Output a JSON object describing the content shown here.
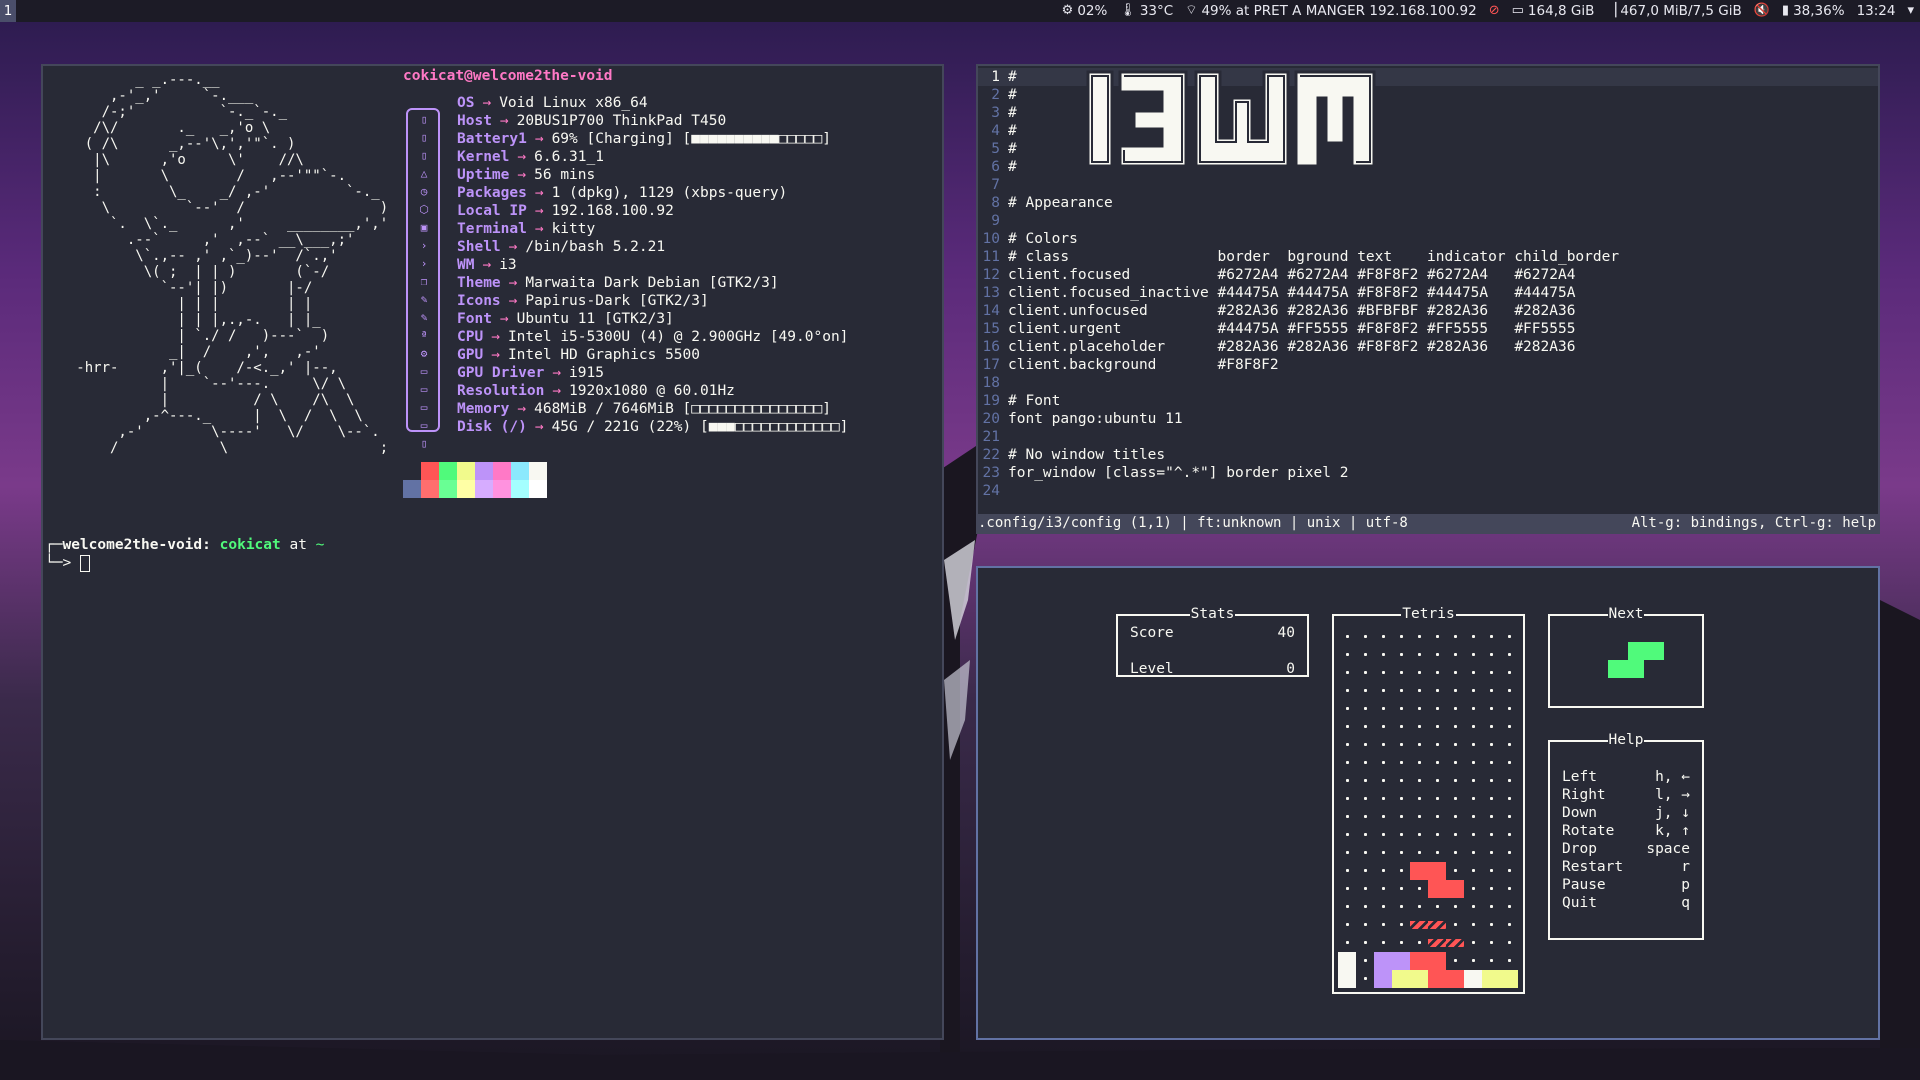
{
  "topbar": {
    "workspace": "1",
    "cpu": "02%",
    "temp": "33°C",
    "wifi": "49% at PRET A MANGER 192.168.100.92",
    "disk": "164,8 GiB",
    "memory": "467,0 MiB/7,5 GiB",
    "battery": "38,36%",
    "clock": "13:24"
  },
  "fastfetch": {
    "title": "cokicat@welcome2the-void",
    "ascii_art": "          _ _.---.__\n       ,-'_,'     `-.___\n      /-;'          `-._`-._\n     /\\/       ._   _,'o \\\n    ( /\\      _,--'\\,','\"`. )\n     |\\      ,'o     \\'    //\\\n     |       \\        /   ,--'\"\"`-.\n     :        \\_    _/ ,-'         `-._\n      \\         `--'  /                )\n       `.  \\`._      ,'     ________,','\n         .--`     ,'  ,--` __\\___,;'\n          \\`.,-- ,' ,`_)--'  /`.,'\n           \\( ;  | | )       (`-/\n             `--'| |)       |-/\n               | | |        | |\n               | | |,.,-.   | |_\n               | `./ /   )---`  )\n              _|  /    ,',   ,-'\n   -hrr-     ,'|_(    /-<._,' |--,\n             |    `--'---.     \\/ \\\n             |          / \\    /\\  \\\n           ,-^---._     |  \\  /  \\  \\\n        ,-'        \\----'   \\/    \\--`.\n       /            \\                  ;",
    "rows": [
      {
        "key": "OS",
        "value": "Void Linux x86_64",
        "icon": "os-icon",
        "glyph": "▯"
      },
      {
        "key": "Host",
        "value": "20BUS1P700 ThinkPad T450",
        "icon": "host-icon",
        "glyph": "▯"
      },
      {
        "key": "Battery1",
        "value": "69% [Charging] [■■■■■■■■■■□□□□□]",
        "icon": "battery-icon",
        "glyph": "▯"
      },
      {
        "key": "Kernel",
        "value": "6.6.31_1",
        "icon": "kernel-icon",
        "glyph": "△"
      },
      {
        "key": "Uptime",
        "value": "56 mins",
        "icon": "clock-icon",
        "glyph": "◷"
      },
      {
        "key": "Packages",
        "value": "1 (dpkg), 1129 (xbps-query)",
        "icon": "package-icon",
        "glyph": "⬡"
      },
      {
        "key": "Local IP",
        "value": "192.168.100.92",
        "icon": "network-icon",
        "glyph": "▣"
      },
      {
        "key": "Terminal",
        "value": "kitty",
        "icon": "terminal-icon",
        "glyph": "›"
      },
      {
        "key": "Shell",
        "value": "/bin/bash 5.2.21",
        "icon": "shell-icon",
        "glyph": "›"
      },
      {
        "key": "WM",
        "value": "i3",
        "icon": "window-icon",
        "glyph": "❐"
      },
      {
        "key": "Theme",
        "value": "Marwaita Dark Debian [GTK2/3]",
        "icon": "brush-icon",
        "glyph": "✎"
      },
      {
        "key": "Icons",
        "value": "Papirus-Dark [GTK2/3]",
        "icon": "brush-icon",
        "glyph": "✎"
      },
      {
        "key": "Font",
        "value": "Ubuntu 11 [GTK2/3]",
        "icon": "font-icon",
        "glyph": "ª"
      },
      {
        "key": "CPU",
        "value": "Intel i5-5300U (4) @ 2.900GHz [49.0°on]",
        "icon": "cpu-icon",
        "glyph": "⚙"
      },
      {
        "key": "GPU",
        "value": "Intel HD Graphics 5500",
        "icon": "monitor-icon",
        "glyph": "▭"
      },
      {
        "key": "GPU Driver",
        "value": "i915",
        "icon": "monitor-icon",
        "glyph": "▭"
      },
      {
        "key": "Resolution",
        "value": "1920x1080 @ 60.01Hz",
        "icon": "monitor-icon",
        "glyph": "▭"
      },
      {
        "key": "Memory",
        "value": "468MiB / 7646MiB [□□□□□□□□□□□□□□□]",
        "icon": "memory-icon",
        "glyph": "▭"
      },
      {
        "key": "Disk (/)",
        "value": "45G / 221G (22%) [■■■□□□□□□□□□□□□]",
        "icon": "disk-icon",
        "glyph": "▯"
      }
    ],
    "palette_top": [
      "#282a36",
      "#ff5555",
      "#50fa7b",
      "#f1fa8c",
      "#bd93f9",
      "#ff79c6",
      "#8be9fd",
      "#f8f8f2"
    ],
    "palette_bottom": [
      "#6272a4",
      "#ff6e6e",
      "#69ff94",
      "#ffffa5",
      "#d6acff",
      "#ff92df",
      "#a4ffff",
      "#ffffff"
    ]
  },
  "prompt": {
    "host": "welcome2the-void",
    "user": "cokicat",
    "at": "at",
    "dir": "~"
  },
  "vim": {
    "lines": [
      {
        "n": "1",
        "t": "#"
      },
      {
        "n": "2",
        "t": "#"
      },
      {
        "n": "3",
        "t": "#"
      },
      {
        "n": "4",
        "t": "#"
      },
      {
        "n": "5",
        "t": "#"
      },
      {
        "n": "6",
        "t": "#"
      },
      {
        "n": "7",
        "t": ""
      },
      {
        "n": "8",
        "t": "# Appearance"
      },
      {
        "n": "9",
        "t": ""
      },
      {
        "n": "10",
        "t": "# Colors"
      },
      {
        "n": "11",
        "t": "# class                 border  bground text    indicator child_border"
      },
      {
        "n": "12",
        "t": "client.focused          #6272A4 #6272A4 #F8F8F2 #6272A4   #6272A4"
      },
      {
        "n": "13",
        "t": "client.focused_inactive #44475A #44475A #F8F8F2 #44475A   #44475A"
      },
      {
        "n": "14",
        "t": "client.unfocused        #282A36 #282A36 #BFBFBF #282A36   #282A36"
      },
      {
        "n": "15",
        "t": "client.urgent           #44475A #FF5555 #F8F8F2 #FF5555   #FF5555"
      },
      {
        "n": "16",
        "t": "client.placeholder      #282A36 #282A36 #F8F8F2 #282A36   #282A36"
      },
      {
        "n": "17",
        "t": "client.background       #F8F8F2"
      },
      {
        "n": "18",
        "t": ""
      },
      {
        "n": "19",
        "t": "# Font"
      },
      {
        "n": "20",
        "t": "font pango:ubuntu 11"
      },
      {
        "n": "21",
        "t": ""
      },
      {
        "n": "22",
        "t": "# No window titles"
      },
      {
        "n": "23",
        "t": "for_window [class=\"^.*\"] border pixel 2"
      },
      {
        "n": "24",
        "t": ""
      }
    ],
    "status_left": ".config/i3/config (1,1) | ft:unknown | unix | utf-8",
    "status_right": "Alt-g: bindings, Ctrl-g: help"
  },
  "tetris": {
    "stats_title": "Stats",
    "score_label": "Score",
    "score": "40",
    "level_label": "Level",
    "level": "0",
    "board_title": "Tetris",
    "next_title": "Next",
    "help_title": "Help",
    "help": [
      {
        "action": "Left",
        "key": "h, ←"
      },
      {
        "action": "Right",
        "key": "l, →"
      },
      {
        "action": "Down",
        "key": "j, ↓"
      },
      {
        "action": "Rotate",
        "key": "k, ↑"
      },
      {
        "action": "Drop",
        "key": "space"
      },
      {
        "action": "Restart",
        "key": "r"
      },
      {
        "action": "Pause",
        "key": "p"
      },
      {
        "action": "Quit",
        "key": "q"
      }
    ],
    "colors": {
      "red": "#ff5555",
      "green": "#50fa7b",
      "yellow": "#f1fa8c",
      "purple": "#bd93f9",
      "white": "#f8f8f2"
    }
  },
  "logo_text": "I3WM"
}
